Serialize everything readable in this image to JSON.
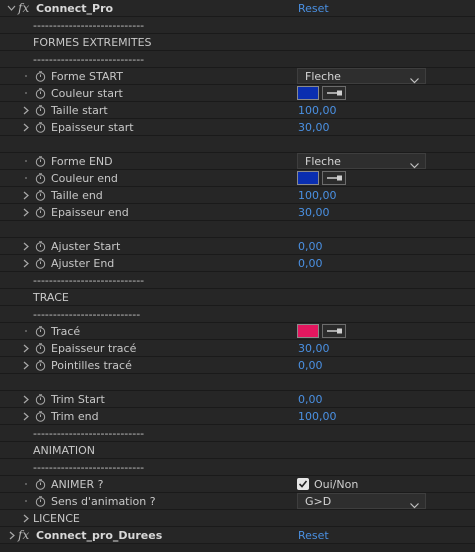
{
  "effect1": {
    "name": "Connect_Pro",
    "reset": "Reset"
  },
  "effect2": {
    "name": "Connect_pro_Durees",
    "reset": "Reset"
  },
  "sep1": "----------------------------",
  "sec1_title": "FORMES EXTREMITES",
  "sep2": "----------------------------",
  "forme_start": {
    "label": "Forme START",
    "value": "Fleche"
  },
  "couleur_start": {
    "label": "Couleur start",
    "color": "#0a2eb0"
  },
  "taille_start": {
    "label": "Taille start",
    "value": "100,00"
  },
  "epaisseur_start": {
    "label": "Epaisseur start",
    "value": "30,00"
  },
  "forme_end": {
    "label": "Forme END",
    "value": "Fleche"
  },
  "couleur_end": {
    "label": "Couleur end",
    "color": "#0a2eb0"
  },
  "taille_end": {
    "label": "Taille end",
    "value": "100,00"
  },
  "epaisseur_end": {
    "label": "Epaisseur end",
    "value": "30,00"
  },
  "ajuster_start": {
    "label": "Ajuster Start",
    "value": "0,00"
  },
  "ajuster_end": {
    "label": "Ajuster End",
    "value": "0,00"
  },
  "sep3": "----------------------------",
  "sec2_title": "TRACE",
  "sep4": "---------------------------",
  "trace": {
    "label": "Tracé",
    "color": "#e3175f"
  },
  "epaisseur_trace": {
    "label": "Epaisseur tracé",
    "value": "30,00"
  },
  "pointilles_trace": {
    "label": "Pointilles tracé",
    "value": "0,00"
  },
  "trim_start": {
    "label": "Trim Start",
    "value": "0,00"
  },
  "trim_end": {
    "label": "Trim end",
    "value": "100,00"
  },
  "sep5": "----------------------------",
  "sec3_title": "ANIMATION",
  "sep6": "----------------------------",
  "animer": {
    "label": "ANIMER ?",
    "checkbox_label": "Oui/Non",
    "checked": true
  },
  "sens": {
    "label": "Sens d'animation ?",
    "value": "G>D"
  },
  "licence": {
    "label": "LICENCE"
  },
  "icons": {
    "twirl_open": "chevron-down-icon",
    "twirl_closed": "chevron-right-icon",
    "stopwatch": "stopwatch-icon",
    "eyedropper": "eyedropper-icon"
  }
}
